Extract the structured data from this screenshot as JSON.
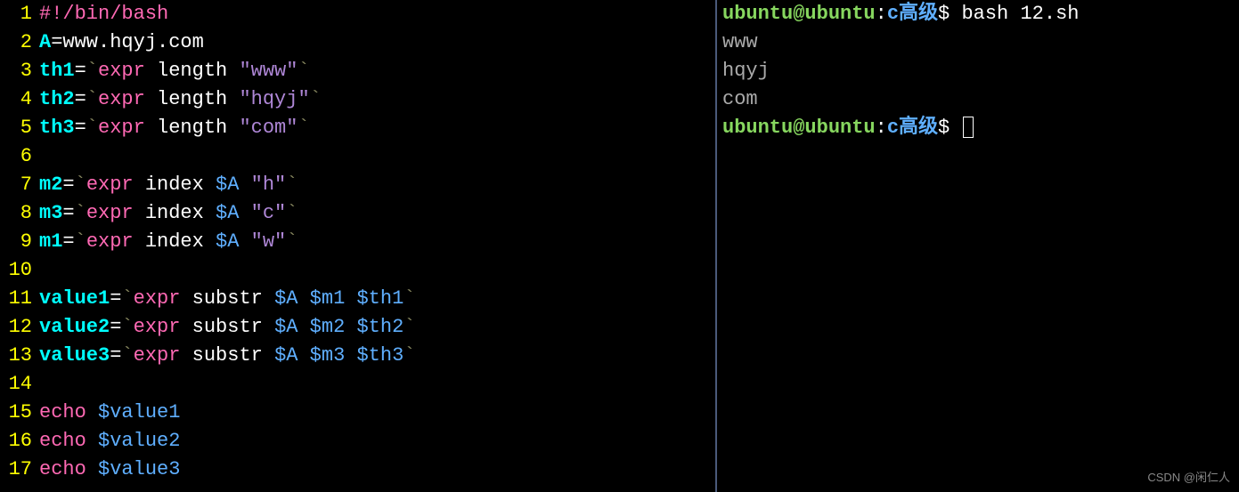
{
  "editor": {
    "lines": [
      {
        "num": "1",
        "tokens": [
          {
            "t": "#!/bin/bash",
            "c": "tok-shebang"
          }
        ]
      },
      {
        "num": "2",
        "tokens": [
          {
            "t": "A",
            "c": "tok-cyan"
          },
          {
            "t": "=www.hqyj.com",
            "c": "tok-white"
          }
        ]
      },
      {
        "num": "3",
        "tokens": [
          {
            "t": "th1",
            "c": "tok-cyan"
          },
          {
            "t": "=",
            "c": "tok-white"
          },
          {
            "t": "`",
            "c": "tok-olive"
          },
          {
            "t": "expr",
            "c": "tok-magenta"
          },
          {
            "t": " length ",
            "c": "tok-white"
          },
          {
            "t": "\"www\"",
            "c": "tok-purple"
          },
          {
            "t": "`",
            "c": "tok-olive"
          }
        ]
      },
      {
        "num": "4",
        "tokens": [
          {
            "t": "th2",
            "c": "tok-cyan"
          },
          {
            "t": "=",
            "c": "tok-white"
          },
          {
            "t": "`",
            "c": "tok-olive"
          },
          {
            "t": "expr",
            "c": "tok-magenta"
          },
          {
            "t": " length ",
            "c": "tok-white"
          },
          {
            "t": "\"hqyj\"",
            "c": "tok-purple"
          },
          {
            "t": "`",
            "c": "tok-olive"
          }
        ]
      },
      {
        "num": "5",
        "tokens": [
          {
            "t": "th3",
            "c": "tok-cyan"
          },
          {
            "t": "=",
            "c": "tok-white"
          },
          {
            "t": "`",
            "c": "tok-olive"
          },
          {
            "t": "expr",
            "c": "tok-magenta"
          },
          {
            "t": " length ",
            "c": "tok-white"
          },
          {
            "t": "\"com\"",
            "c": "tok-purple"
          },
          {
            "t": "`",
            "c": "tok-olive"
          }
        ]
      },
      {
        "num": "6",
        "tokens": []
      },
      {
        "num": "7",
        "tokens": [
          {
            "t": "m2",
            "c": "tok-cyan"
          },
          {
            "t": "=",
            "c": "tok-white"
          },
          {
            "t": "`",
            "c": "tok-olive"
          },
          {
            "t": "expr",
            "c": "tok-magenta"
          },
          {
            "t": " index ",
            "c": "tok-white"
          },
          {
            "t": "$A",
            "c": "tok-blue"
          },
          {
            "t": " ",
            "c": "tok-white"
          },
          {
            "t": "\"h\"",
            "c": "tok-purple"
          },
          {
            "t": "`",
            "c": "tok-olive"
          }
        ]
      },
      {
        "num": "8",
        "tokens": [
          {
            "t": "m3",
            "c": "tok-cyan"
          },
          {
            "t": "=",
            "c": "tok-white"
          },
          {
            "t": "`",
            "c": "tok-olive"
          },
          {
            "t": "expr",
            "c": "tok-magenta"
          },
          {
            "t": " index ",
            "c": "tok-white"
          },
          {
            "t": "$A",
            "c": "tok-blue"
          },
          {
            "t": " ",
            "c": "tok-white"
          },
          {
            "t": "\"c\"",
            "c": "tok-purple"
          },
          {
            "t": "`",
            "c": "tok-olive"
          }
        ]
      },
      {
        "num": "9",
        "tokens": [
          {
            "t": "m1",
            "c": "tok-cyan"
          },
          {
            "t": "=",
            "c": "tok-white"
          },
          {
            "t": "`",
            "c": "tok-olive"
          },
          {
            "t": "expr",
            "c": "tok-magenta"
          },
          {
            "t": " index ",
            "c": "tok-white"
          },
          {
            "t": "$A",
            "c": "tok-blue"
          },
          {
            "t": " ",
            "c": "tok-white"
          },
          {
            "t": "\"w\"",
            "c": "tok-purple"
          },
          {
            "t": "`",
            "c": "tok-olive"
          }
        ]
      },
      {
        "num": "10",
        "tokens": []
      },
      {
        "num": "11",
        "tokens": [
          {
            "t": "value1",
            "c": "tok-cyan"
          },
          {
            "t": "=",
            "c": "tok-white"
          },
          {
            "t": "`",
            "c": "tok-olive"
          },
          {
            "t": "expr",
            "c": "tok-magenta"
          },
          {
            "t": " substr ",
            "c": "tok-white"
          },
          {
            "t": "$A",
            "c": "tok-blue"
          },
          {
            "t": " ",
            "c": "tok-white"
          },
          {
            "t": "$m1",
            "c": "tok-blue"
          },
          {
            "t": " ",
            "c": "tok-white"
          },
          {
            "t": "$th1",
            "c": "tok-blue"
          },
          {
            "t": "`",
            "c": "tok-olive"
          }
        ]
      },
      {
        "num": "12",
        "tokens": [
          {
            "t": "value2",
            "c": "tok-cyan"
          },
          {
            "t": "=",
            "c": "tok-white"
          },
          {
            "t": "`",
            "c": "tok-olive"
          },
          {
            "t": "expr",
            "c": "tok-magenta"
          },
          {
            "t": " substr ",
            "c": "tok-white"
          },
          {
            "t": "$A",
            "c": "tok-blue"
          },
          {
            "t": " ",
            "c": "tok-white"
          },
          {
            "t": "$m2",
            "c": "tok-blue"
          },
          {
            "t": " ",
            "c": "tok-white"
          },
          {
            "t": "$th2",
            "c": "tok-blue"
          },
          {
            "t": "`",
            "c": "tok-olive"
          }
        ]
      },
      {
        "num": "13",
        "tokens": [
          {
            "t": "value3",
            "c": "tok-cyan"
          },
          {
            "t": "=",
            "c": "tok-white"
          },
          {
            "t": "`",
            "c": "tok-olive"
          },
          {
            "t": "expr",
            "c": "tok-magenta"
          },
          {
            "t": " substr ",
            "c": "tok-white"
          },
          {
            "t": "$A",
            "c": "tok-blue"
          },
          {
            "t": " ",
            "c": "tok-white"
          },
          {
            "t": "$m3",
            "c": "tok-blue"
          },
          {
            "t": " ",
            "c": "tok-white"
          },
          {
            "t": "$th3",
            "c": "tok-blue"
          },
          {
            "t": "`",
            "c": "tok-olive"
          }
        ]
      },
      {
        "num": "14",
        "tokens": []
      },
      {
        "num": "15",
        "tokens": [
          {
            "t": "echo",
            "c": "tok-magenta"
          },
          {
            "t": " ",
            "c": "tok-white"
          },
          {
            "t": "$value1",
            "c": "tok-blue"
          }
        ]
      },
      {
        "num": "16",
        "tokens": [
          {
            "t": "echo",
            "c": "tok-magenta"
          },
          {
            "t": " ",
            "c": "tok-white"
          },
          {
            "t": "$value2",
            "c": "tok-blue"
          }
        ]
      },
      {
        "num": "17",
        "tokens": [
          {
            "t": "echo",
            "c": "tok-magenta"
          },
          {
            "t": " ",
            "c": "tok-white"
          },
          {
            "t": "$value3",
            "c": "tok-blue"
          }
        ]
      }
    ]
  },
  "terminal": {
    "prompt": {
      "userhost": "ubuntu@ubuntu",
      "colon": ":",
      "path": "c高级",
      "dollar": "$ "
    },
    "command": "bash 12.sh",
    "output": [
      "www",
      "hqyj",
      "com"
    ]
  },
  "watermark": "CSDN @闲仁人"
}
